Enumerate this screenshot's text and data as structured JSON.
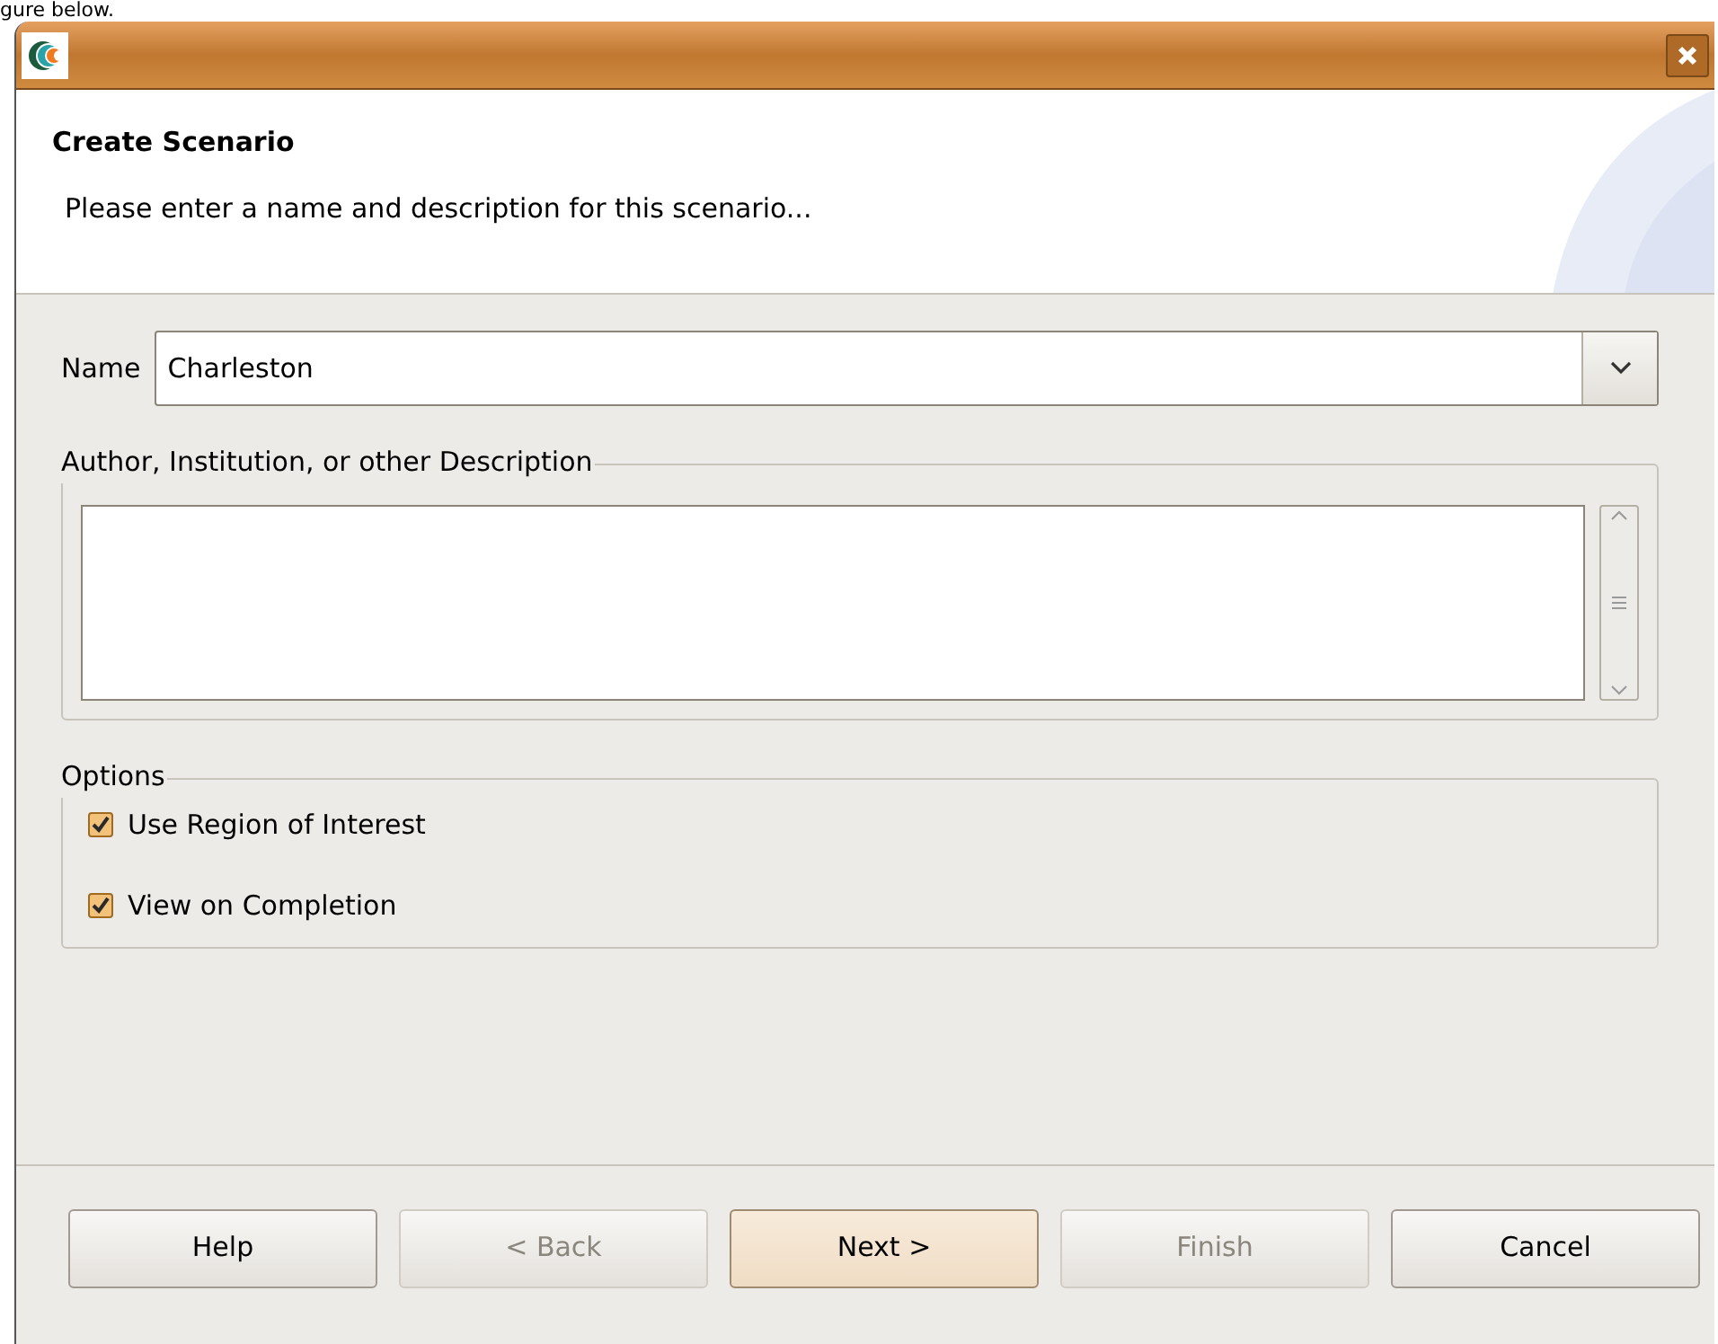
{
  "caption": "gure below.",
  "header": {
    "title": "Create Scenario",
    "subtitle": "Please enter a name and description for this scenario..."
  },
  "name_field": {
    "label": "Name",
    "value": "Charleston"
  },
  "description": {
    "legend": "Author, Institution, or other Description"
  },
  "options": {
    "legend": "Options",
    "items": [
      {
        "label": "Use Region of Interest",
        "checked": true
      },
      {
        "label": "View on Completion",
        "checked": true
      }
    ]
  },
  "buttons": [
    {
      "label": "Help",
      "disabled": false,
      "default": false
    },
    {
      "label": "< Back",
      "disabled": true,
      "default": false
    },
    {
      "label": "Next >",
      "disabled": false,
      "default": true
    },
    {
      "label": "Finish",
      "disabled": true,
      "default": false
    },
    {
      "label": "Cancel",
      "disabled": false,
      "default": false
    }
  ]
}
